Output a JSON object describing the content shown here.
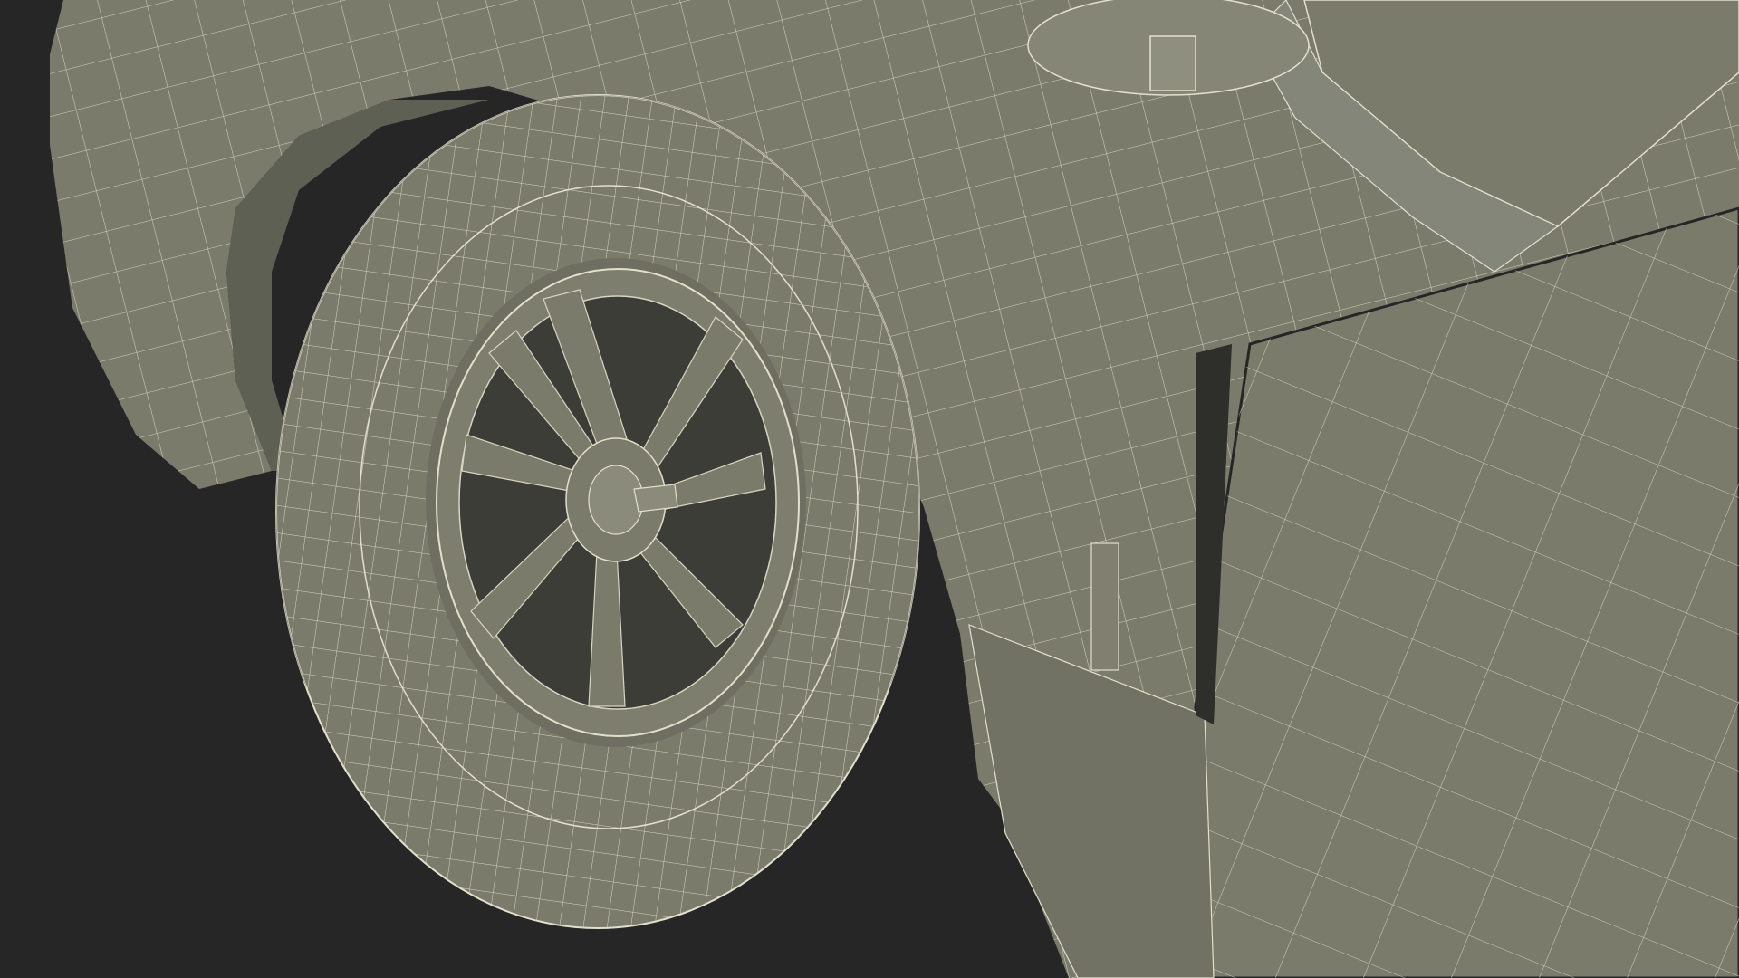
{
  "scene": {
    "subject": "wireframe-car-front-wheel",
    "colors": {
      "background": "#262626",
      "surface": "#7a7b6b",
      "surface_shadow": "#5f6054",
      "wire": "#e2e0cc",
      "wire_dense": "#d8d6c2",
      "wheel_dark": "#3c3d36"
    }
  }
}
